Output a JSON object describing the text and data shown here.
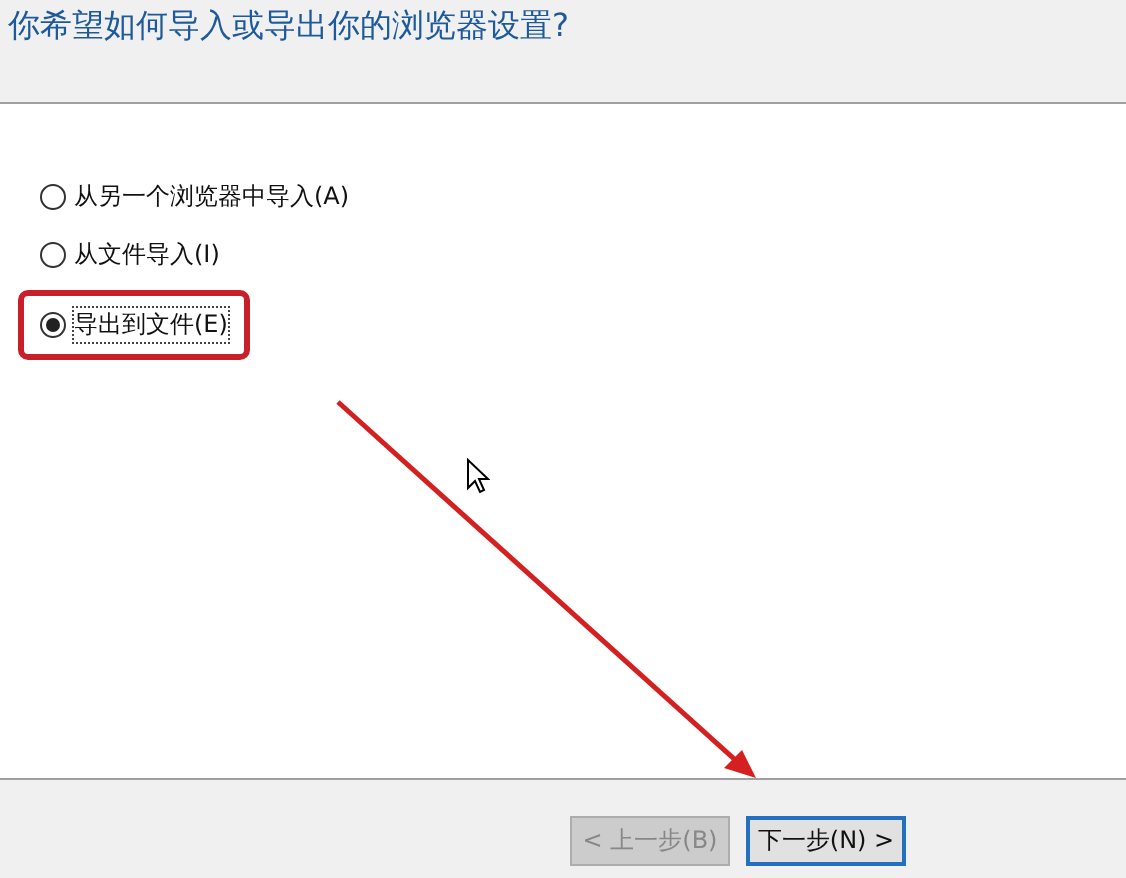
{
  "heading": "你希望如何导入或导出你的浏览器设置?",
  "options": [
    {
      "label": "从另一个浏览器中导入(A)",
      "selected": false,
      "highlighted": false
    },
    {
      "label": "从文件导入(I)",
      "selected": false,
      "highlighted": false
    },
    {
      "label": "导出到文件(E)",
      "selected": true,
      "highlighted": true
    }
  ],
  "buttons": [
    {
      "label": "< 上一步(B)",
      "disabled": true,
      "default": false
    },
    {
      "label": "下一步(N) >",
      "disabled": false,
      "default": true
    }
  ]
}
